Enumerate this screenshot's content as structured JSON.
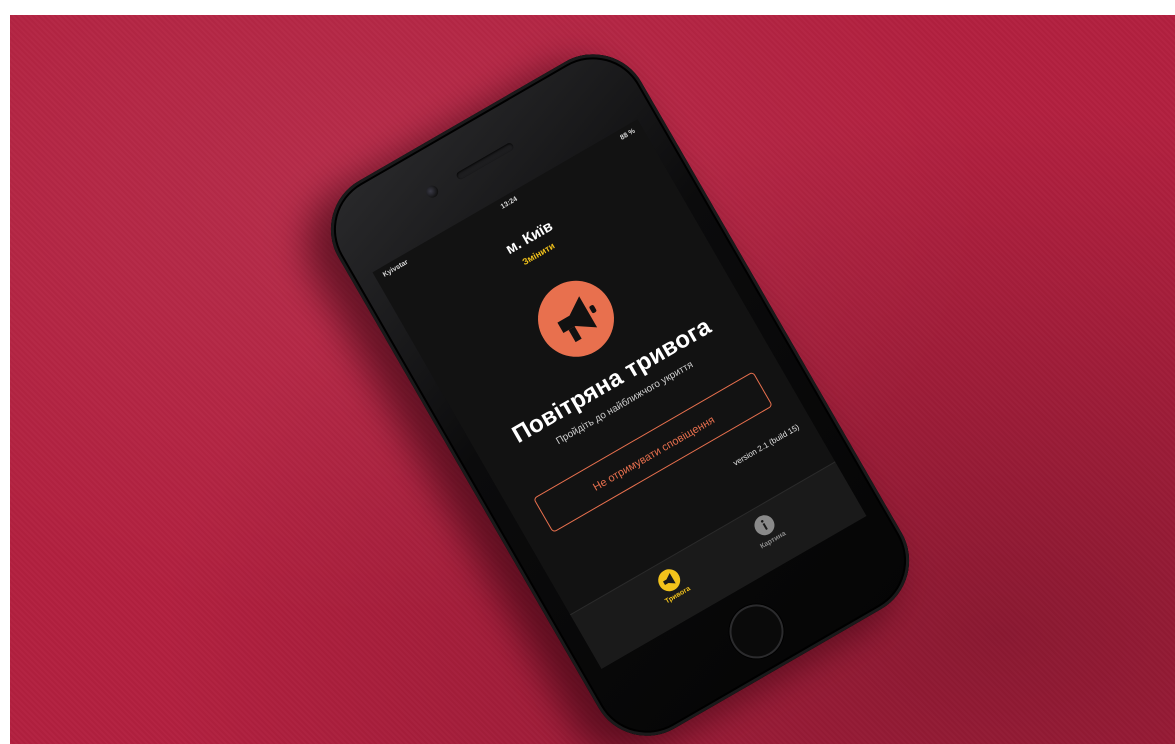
{
  "photo": {
    "background_color": "#b2203f",
    "phone_color": "#0b0b0c"
  },
  "status_bar": {
    "carrier": "Kyivstar",
    "time": "13:24",
    "battery": "88 %"
  },
  "header": {
    "city": "м. Київ",
    "change_link": "Змінити"
  },
  "alert": {
    "icon": "megaphone-icon",
    "icon_color": "#e8704e",
    "title": "Повітряна тривога",
    "subtitle": "Пройдіть до найближчого укриття",
    "mute_button": "Не отримувати сповіщення"
  },
  "footer": {
    "version": "version 2.1 (build 15)"
  },
  "tabs": [
    {
      "label": "Тривога",
      "icon": "megaphone-icon",
      "active": true,
      "color": "#f2c21b"
    },
    {
      "label": "Картина",
      "icon": "info-icon",
      "active": false,
      "color": "#8a8a8a"
    }
  ]
}
